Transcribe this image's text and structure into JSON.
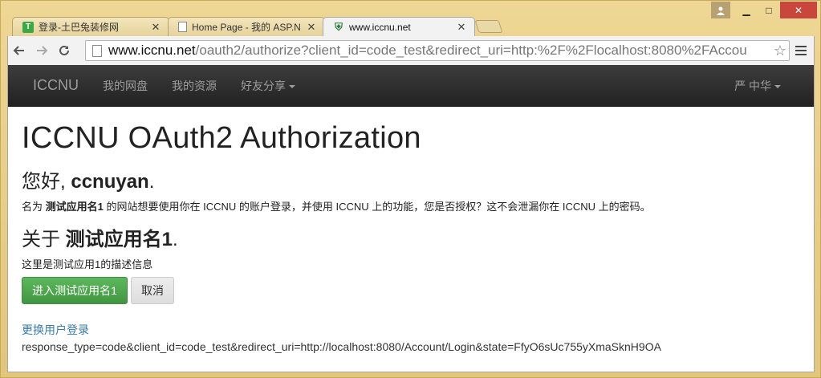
{
  "window": {
    "controls": {
      "minimize": "▁",
      "maximize": "□",
      "close": "✕"
    }
  },
  "tabs": [
    {
      "title": "登录-土巴兔装修网",
      "favicon": "T",
      "active": false
    },
    {
      "title": "Home Page - 我的 ASP.N",
      "favicon": "doc-icon",
      "active": false
    },
    {
      "title": "www.iccnu.net",
      "favicon": "shield-icon",
      "active": true
    }
  ],
  "toolbar": {
    "url_host": "www.iccnu.net",
    "url_rest": "/oauth2/authorize?client_id=code_test&redirect_uri=http:%2F%2Flocalhost:8080%2FAccou"
  },
  "navbar": {
    "brand": "ICCNU",
    "links": [
      "我的网盘",
      "我的资源",
      "好友分享"
    ],
    "user": "严 中华"
  },
  "page": {
    "title": "ICCNU OAuth2 Authorization",
    "greeting_prefix": "您好, ",
    "username": "ccnuyan",
    "greeting_suffix": ".",
    "desc_prefix": "名为 ",
    "app_name": "测试应用名1",
    "desc_suffix": " 的网站想要使用你在 ICCNU 的账户登录，并使用 ICCNU 上的功能，您是否授权？这不会泄漏你在 ICCNU 上的密码。",
    "about_prefix": "关于 ",
    "about_suffix": ".",
    "app_description": "这里是测试应用1的描述信息",
    "enter_button": "进入测试应用名1",
    "cancel_button": "取消",
    "switch_user_link": "更换用户登录",
    "response_text": "response_type=code&client_id=code_test&redirect_uri=http://localhost:8080/Account/Login&state=FfyO6sUc755yXmaSknH9OA"
  }
}
